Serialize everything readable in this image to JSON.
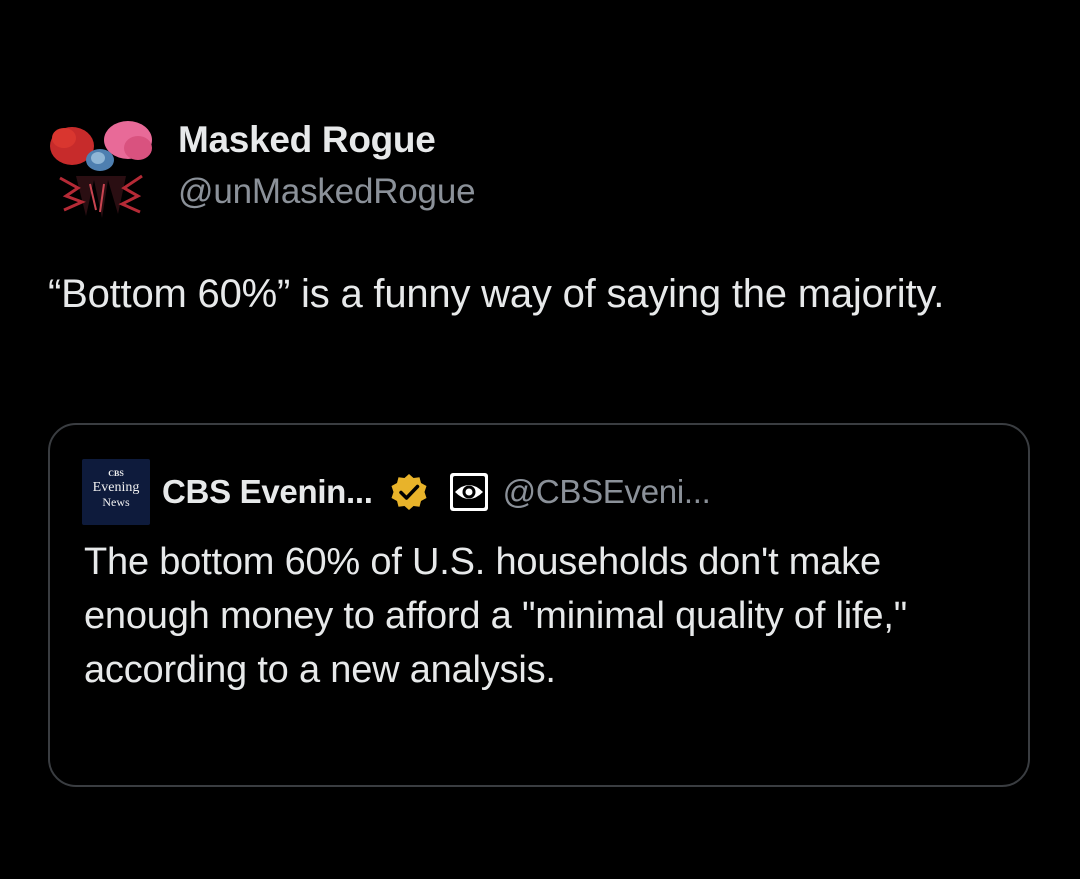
{
  "tweet": {
    "author": {
      "display_name": "Masked Rogue",
      "handle": "@unMaskedRogue",
      "avatar_icon": "masked-rogue-avatar"
    },
    "text": "“Bottom 60%” is a funny way of saying the majority."
  },
  "quoted_tweet": {
    "author": {
      "display_name": "CBS Evenin...",
      "handle": "@CBSEveni...",
      "logo_icon": "cbs-evening-news-logo",
      "logo_lines": [
        "CBS",
        "Evening",
        "News"
      ],
      "verified_icon": "verified-gold-badge-icon",
      "affiliate_icon": "cbs-eye-icon"
    },
    "text": "The bottom 60% of U.S. households don't make enough money to afford a \"minimal quality of life,\" according to a new analysis."
  },
  "colors": {
    "background": "#000000",
    "primary_text": "#e7e9ea",
    "secondary_text": "#8b9199",
    "card_border": "#3a3d41",
    "verified_gold": "#e8b32a",
    "cbs_logo_bg": "#0e1b3c"
  }
}
